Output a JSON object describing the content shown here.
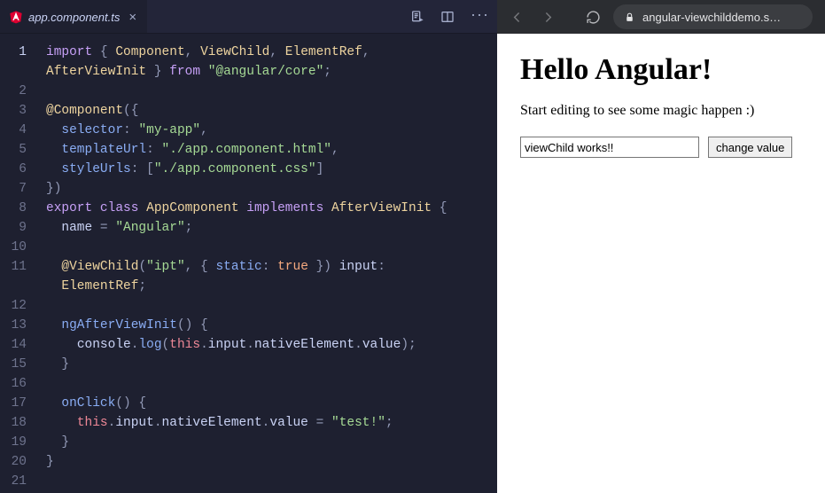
{
  "editor": {
    "tab": {
      "filename": "app.component.ts"
    },
    "gutter_active_line": 1,
    "lines": [
      [
        {
          "t": "import",
          "c": "kw"
        },
        {
          "t": " { ",
          "c": "pn"
        },
        {
          "t": "Component",
          "c": "cls"
        },
        {
          "t": ", ",
          "c": "pn"
        },
        {
          "t": "ViewChild",
          "c": "cls"
        },
        {
          "t": ", ",
          "c": "pn"
        },
        {
          "t": "ElementRef",
          "c": "cls"
        },
        {
          "t": ",",
          "c": "pn"
        }
      ],
      [
        {
          "t": "AfterViewInit",
          "c": "cls"
        },
        {
          "t": " } ",
          "c": "pn"
        },
        {
          "t": "from",
          "c": "kw"
        },
        {
          "t": " ",
          "c": "pn"
        },
        {
          "t": "\"@angular/core\"",
          "c": "str"
        },
        {
          "t": ";",
          "c": "pn"
        }
      ],
      [],
      [
        {
          "t": "@",
          "c": "dec"
        },
        {
          "t": "Component",
          "c": "dec"
        },
        {
          "t": "({",
          "c": "pn"
        }
      ],
      [
        {
          "t": "  ",
          "c": "pn"
        },
        {
          "t": "selector",
          "c": "prop"
        },
        {
          "t": ": ",
          "c": "pn"
        },
        {
          "t": "\"my-app\"",
          "c": "str"
        },
        {
          "t": ",",
          "c": "pn"
        }
      ],
      [
        {
          "t": "  ",
          "c": "pn"
        },
        {
          "t": "templateUrl",
          "c": "prop"
        },
        {
          "t": ": ",
          "c": "pn"
        },
        {
          "t": "\"./app.component.html\"",
          "c": "str"
        },
        {
          "t": ",",
          "c": "pn"
        }
      ],
      [
        {
          "t": "  ",
          "c": "pn"
        },
        {
          "t": "styleUrls",
          "c": "prop"
        },
        {
          "t": ": [",
          "c": "pn"
        },
        {
          "t": "\"./app.component.css\"",
          "c": "str"
        },
        {
          "t": "]",
          "c": "pn"
        }
      ],
      [
        {
          "t": "})",
          "c": "pn"
        }
      ],
      [
        {
          "t": "export",
          "c": "kw"
        },
        {
          "t": " ",
          "c": "pn"
        },
        {
          "t": "class",
          "c": "kw"
        },
        {
          "t": " ",
          "c": "pn"
        },
        {
          "t": "AppComponent",
          "c": "cls"
        },
        {
          "t": " ",
          "c": "pn"
        },
        {
          "t": "implements",
          "c": "kw"
        },
        {
          "t": " ",
          "c": "pn"
        },
        {
          "t": "AfterViewInit",
          "c": "cls"
        },
        {
          "t": " {",
          "c": "pn"
        }
      ],
      [
        {
          "t": "  ",
          "c": "pn"
        },
        {
          "t": "name",
          "c": "var"
        },
        {
          "t": " = ",
          "c": "pn"
        },
        {
          "t": "\"Angular\"",
          "c": "str"
        },
        {
          "t": ";",
          "c": "pn"
        }
      ],
      [],
      [
        {
          "t": "  ",
          "c": "pn"
        },
        {
          "t": "@",
          "c": "dec"
        },
        {
          "t": "ViewChild",
          "c": "dec"
        },
        {
          "t": "(",
          "c": "pn"
        },
        {
          "t": "\"ipt\"",
          "c": "str"
        },
        {
          "t": ", { ",
          "c": "pn"
        },
        {
          "t": "static",
          "c": "prop"
        },
        {
          "t": ": ",
          "c": "pn"
        },
        {
          "t": "true",
          "c": "bool"
        },
        {
          "t": " }) ",
          "c": "pn"
        },
        {
          "t": "input",
          "c": "var"
        },
        {
          "t": ":",
          "c": "pn"
        }
      ],
      [
        {
          "t": "  ",
          "c": "pn"
        },
        {
          "t": "ElementRef",
          "c": "cls"
        },
        {
          "t": ";",
          "c": "pn"
        }
      ],
      [],
      [
        {
          "t": "  ",
          "c": "pn"
        },
        {
          "t": "ngAfterViewInit",
          "c": "fn"
        },
        {
          "t": "() {",
          "c": "pn"
        }
      ],
      [
        {
          "t": "    ",
          "c": "pn"
        },
        {
          "t": "console",
          "c": "var"
        },
        {
          "t": ".",
          "c": "pn"
        },
        {
          "t": "log",
          "c": "fn"
        },
        {
          "t": "(",
          "c": "pn"
        },
        {
          "t": "this",
          "c": "this"
        },
        {
          "t": ".",
          "c": "pn"
        },
        {
          "t": "input",
          "c": "var"
        },
        {
          "t": ".",
          "c": "pn"
        },
        {
          "t": "nativeElement",
          "c": "var"
        },
        {
          "t": ".",
          "c": "pn"
        },
        {
          "t": "value",
          "c": "var"
        },
        {
          "t": ");",
          "c": "pn"
        }
      ],
      [
        {
          "t": "  }",
          "c": "pn"
        }
      ],
      [],
      [
        {
          "t": "  ",
          "c": "pn"
        },
        {
          "t": "onClick",
          "c": "fn"
        },
        {
          "t": "() {",
          "c": "pn"
        }
      ],
      [
        {
          "t": "    ",
          "c": "pn"
        },
        {
          "t": "this",
          "c": "this"
        },
        {
          "t": ".",
          "c": "pn"
        },
        {
          "t": "input",
          "c": "var"
        },
        {
          "t": ".",
          "c": "pn"
        },
        {
          "t": "nativeElement",
          "c": "var"
        },
        {
          "t": ".",
          "c": "pn"
        },
        {
          "t": "value",
          "c": "var"
        },
        {
          "t": " = ",
          "c": "pn"
        },
        {
          "t": "\"test!\"",
          "c": "str"
        },
        {
          "t": ";",
          "c": "pn"
        }
      ],
      [
        {
          "t": "  }",
          "c": "pn"
        }
      ],
      [
        {
          "t": "}",
          "c": "pn"
        }
      ],
      []
    ],
    "line_numbers": [
      "1",
      "",
      "2",
      "3",
      "4",
      "5",
      "6",
      "7",
      "8",
      "9",
      "10",
      "11",
      "",
      "12",
      "13",
      "14",
      "15",
      "16",
      "17",
      "18",
      "19",
      "20",
      "21"
    ]
  },
  "browser": {
    "url_display": "angular-viewchilddemo.s…"
  },
  "preview": {
    "heading": "Hello Angular!",
    "paragraph": "Start editing to see some magic happen :)",
    "input_value": "viewChild works!!",
    "button_label": "change value"
  }
}
